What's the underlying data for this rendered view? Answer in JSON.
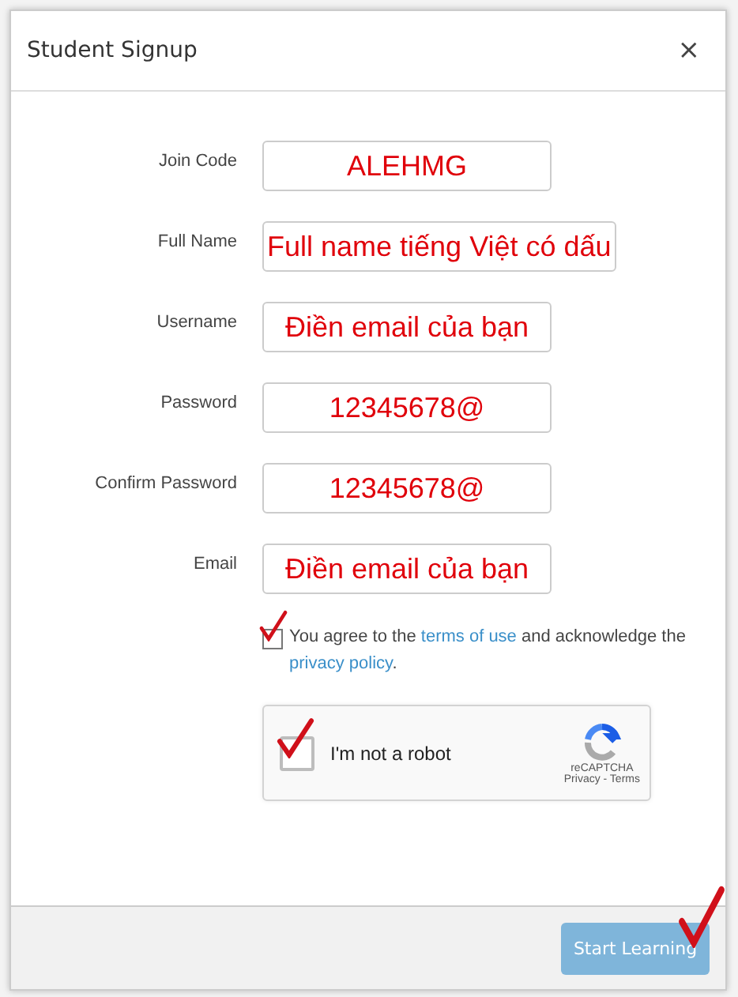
{
  "dialog": {
    "title": "Student Signup",
    "close": "×"
  },
  "fields": [
    {
      "label": "Join Code",
      "value": "ALEHMG"
    },
    {
      "label": "Full Name",
      "value": "Full name tiếng Việt có dấu"
    },
    {
      "label": "Username",
      "value": "Điền email của bạn"
    },
    {
      "label": "Password",
      "value": "12345678@"
    },
    {
      "label": "Confirm Password",
      "value": "12345678@"
    },
    {
      "label": "Email",
      "value": "Điền email của bạn"
    }
  ],
  "terms": {
    "checked": true,
    "before": "You agree to the",
    "link1": "terms of use",
    "middle": "and acknowledge the",
    "link2": "privacy policy",
    "after": "."
  },
  "captcha": {
    "checked": true,
    "label": "I'm not a robot",
    "brand": "reCAPTCHA",
    "links": "Privacy - Terms"
  },
  "submit": {
    "label": "Start Learning",
    "disabled": true
  }
}
